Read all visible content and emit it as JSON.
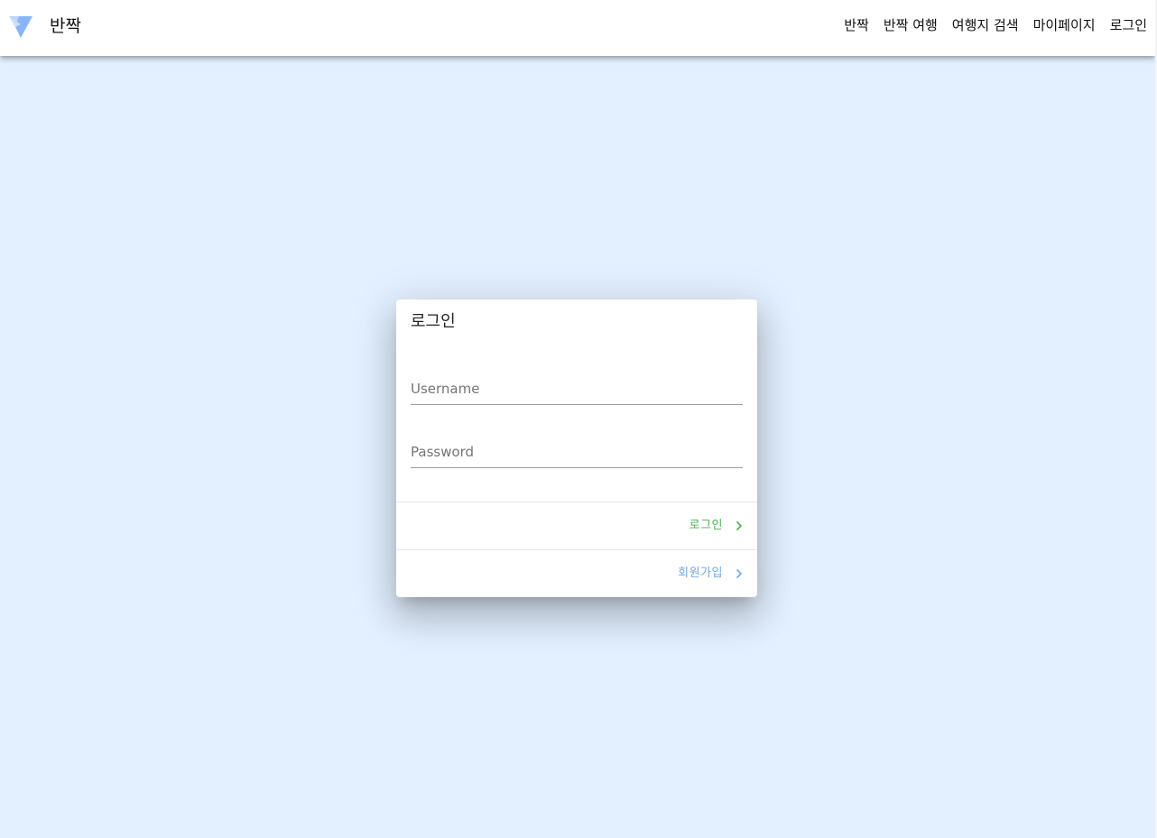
{
  "app": {
    "brand": "반짝",
    "nav": [
      "반짝",
      "반짝 여행",
      "여행지 검색",
      "마이페이지",
      "로그인"
    ]
  },
  "login_card": {
    "title": "로그인",
    "username_placeholder": "Username",
    "password_placeholder": "Password",
    "login_label": "로그인",
    "signup_label": "회원가입"
  },
  "colors": {
    "background": "#e3f0ff",
    "login_accent": "#4caf50",
    "signup_accent": "#6fa8e8",
    "logo_primary": "#8ab4f8"
  },
  "icons": [
    "vuetify-logo-icon",
    "chevron-right-icon"
  ]
}
